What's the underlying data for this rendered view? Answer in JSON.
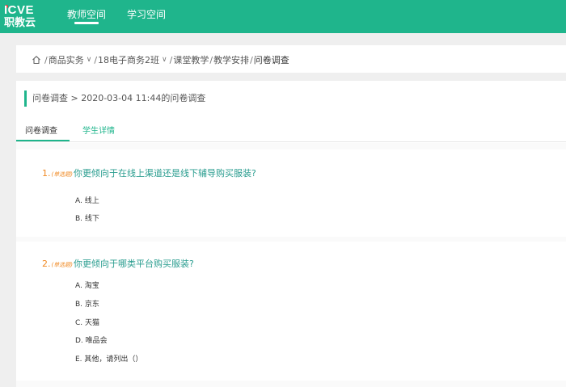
{
  "header": {
    "logo_top": "ICVE",
    "logo_bottom": "职教云",
    "nav": [
      {
        "label": "教师空间",
        "active": true
      },
      {
        "label": "学习空间",
        "active": false
      }
    ],
    "accent_color": "#1fb58c"
  },
  "breadcrumb": {
    "items": [
      "商品实务",
      "18电子商务2班",
      "课堂教学",
      "教学安排",
      "问卷调查"
    ]
  },
  "page": {
    "title": "问卷调查 > 2020-03-04 11:44的问卷调查",
    "tabs": [
      {
        "label": "问卷调查",
        "active": true
      },
      {
        "label": "学生详情",
        "active": false
      }
    ]
  },
  "questions": [
    {
      "number": "1.",
      "type": "(单选题)",
      "text": "你更倾向于在线上渠道还是线下辅导购买服装?",
      "options": [
        "A. 线上",
        "B. 线下"
      ]
    },
    {
      "number": "2.",
      "type": "(单选题)",
      "text": "你更倾向于哪类平台购买服装?",
      "options": [
        "A. 淘宝",
        "B. 京东",
        "C. 天猫",
        "D. 唯品会",
        "E. 其他，请列出（）"
      ]
    }
  ]
}
